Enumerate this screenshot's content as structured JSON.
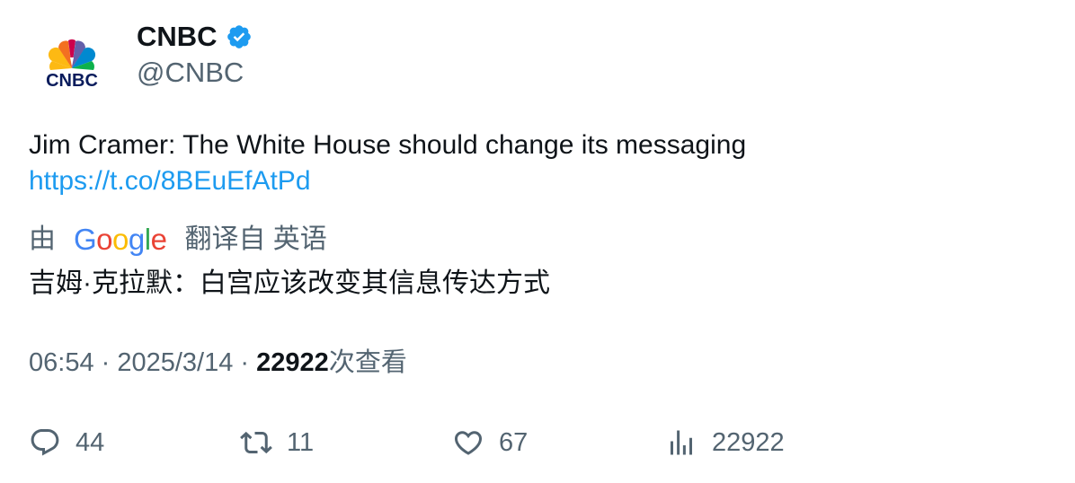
{
  "author": {
    "name": "CNBC",
    "handle": "@CNBC",
    "avatar_logo_text": "CNBC"
  },
  "tweet": {
    "text": "Jim Cramer: The White House should change its messaging",
    "link": "https://t.co/8BEuEfAtPd"
  },
  "translation": {
    "prefix": "由",
    "provider": "Google",
    "suffix": "翻译自 英语",
    "text": "吉姆·克拉默：白宫应该改变其信息传达方式"
  },
  "meta": {
    "time": "06:54",
    "separator1": " · ",
    "date": "2025/3/14",
    "separator2": " · ",
    "views": "22922",
    "views_label": "次查看"
  },
  "actions": {
    "replies": "44",
    "retweets": "11",
    "likes": "67",
    "views": "22922"
  },
  "colors": {
    "link": "#1d9bf0",
    "verified": "#1d9bf0",
    "secondary_text": "#536471",
    "primary_text": "#0f1419"
  },
  "icons": [
    "verified-badge-icon",
    "reply-icon",
    "retweet-icon",
    "like-icon",
    "analytics-icon"
  ]
}
